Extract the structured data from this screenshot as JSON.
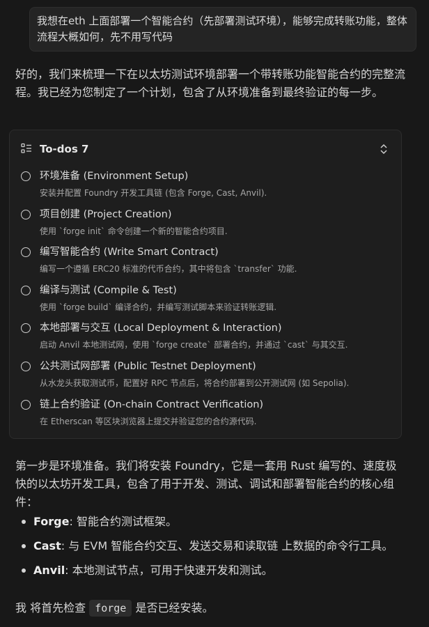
{
  "user_message": "我想在eth 上面部署一个智能合约（先部署测试环境），能够完成转账功能，整体流程大概如何，先不用写代码",
  "assistant_intro": "好的，我们来梳理一下在以太坊测试环境部署一个带转账功能智能合约的完整流程。我已经为您制定了一个计划，包含了从环境准备到最终验证的每一步。",
  "todos": {
    "title": "To-dos 7",
    "items": [
      {
        "title": "环境准备 (Environment Setup)",
        "desc": "安装并配置 Foundry 开发工具链 (包含 Forge, Cast, Anvil)."
      },
      {
        "title": "项目创建 (Project Creation)",
        "desc": "使用 `forge init` 命令创建一个新的智能合约项目."
      },
      {
        "title": "编写智能合约 (Write Smart Contract)",
        "desc": "编写一个遵循 ERC20 标准的代币合约，其中将包含 `transfer` 功能."
      },
      {
        "title": "编译与测试 (Compile & Test)",
        "desc": "使用 `forge build` 编译合约，并编写测试脚本来验证转账逻辑."
      },
      {
        "title": "本地部署与交互 (Local Deployment & Interaction)",
        "desc": "启动 Anvil 本地测试网，使用 `forge create` 部署合约，并通过 `cast` 与其交互."
      },
      {
        "title": "公共测试网部署 (Public Testnet Deployment)",
        "desc": "从水龙头获取测试币，配置好 RPC 节点后，将合约部署到公开测试网 (如 Sepolia)."
      },
      {
        "title": "链上合约验证 (On-chain Contract Verification)",
        "desc": "在 Etherscan 等区块浏览器上提交并验证您的合约源代码."
      }
    ]
  },
  "step_intro": "第一步是环境准备。我们将安装 Foundry，它是一套用 Rust 编写的、速度极快的以太坊开发工具，包含了用于开发、测试、调试和部署智能合约的核心组件：",
  "bullets": [
    {
      "term": "Forge",
      "text": ": 智能合约测试框架。"
    },
    {
      "term": "Cast",
      "text": ": 与 EVM 智能合约交互、发送交易和读取链 上数据的命令行工具。"
    },
    {
      "term": "Anvil",
      "text": ": 本地测试节点，可用于快速开发和测试。"
    }
  ],
  "final": {
    "before": "我 将首先检查",
    "code": "forge",
    "after": "是否已经安装。"
  }
}
